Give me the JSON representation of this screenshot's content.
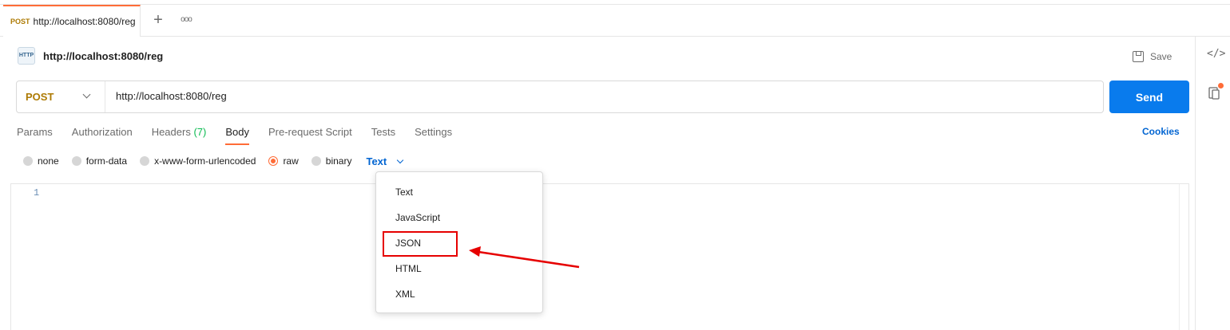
{
  "tabbar": {
    "tab": {
      "method": "POST",
      "name": "http://localhost:8080/reg"
    },
    "new_tab_glyph": "+",
    "more_glyph": "ooo"
  },
  "request": {
    "icon_text": "HTTP",
    "title": "http://localhost:8080/reg",
    "save_label": "Save",
    "method": "POST",
    "url": "http://localhost:8080/reg",
    "send_label": "Send"
  },
  "req_tabs": [
    {
      "label": "Params"
    },
    {
      "label": "Authorization"
    },
    {
      "label": "Headers",
      "count": "(7)"
    },
    {
      "label": "Body",
      "active": true
    },
    {
      "label": "Pre-request Script"
    },
    {
      "label": "Tests"
    },
    {
      "label": "Settings"
    }
  ],
  "cookies_label": "Cookies",
  "body_types": [
    {
      "label": "none"
    },
    {
      "label": "form-data"
    },
    {
      "label": "x-www-form-urlencoded"
    },
    {
      "label": "raw",
      "checked": true
    },
    {
      "label": "binary"
    }
  ],
  "language_selected": "Text",
  "editor": {
    "line_number": "1"
  },
  "language_options": [
    "Text",
    "JavaScript",
    "JSON",
    "HTML",
    "XML"
  ],
  "colors": {
    "accent": "#ff6c37",
    "send": "#097bed",
    "method_post": "#ad7a03",
    "link": "#0265d2",
    "annotation": "#e60000"
  }
}
